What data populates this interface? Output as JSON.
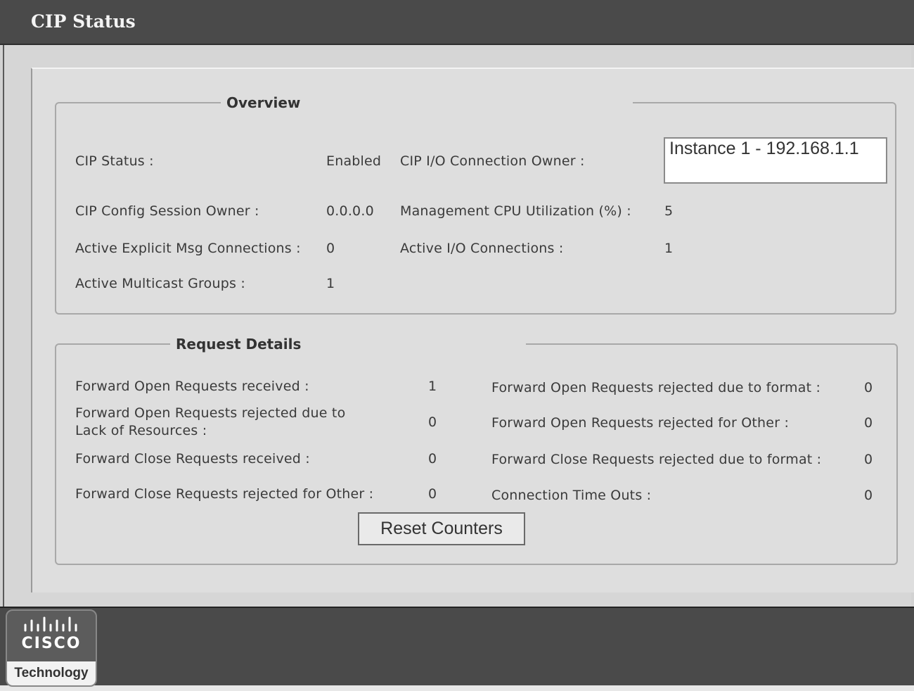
{
  "window": {
    "title": "CIP Status"
  },
  "overview": {
    "legend": "Overview",
    "cip_status_label": "CIP Status :",
    "cip_status_value": "Enabled",
    "io_owner_label": "CIP I/O Connection Owner :",
    "io_owner_value": "Instance 1 - 192.168.1.1",
    "config_owner_label": "CIP Config Session Owner :",
    "config_owner_value": "0.0.0.0",
    "cpu_label": "Management CPU Utilization (%) :",
    "cpu_value": "5",
    "explicit_label": "Active Explicit Msg Connections :",
    "explicit_value": "0",
    "io_conn_label": "Active I/O Connections :",
    "io_conn_value": "1",
    "multicast_label": "Active Multicast Groups :",
    "multicast_value": "1"
  },
  "request_details": {
    "legend": "Request Details",
    "left": [
      {
        "label": "Forward Open Requests received :",
        "value": "1"
      },
      {
        "label_line1": "Forward Open Requests rejected due to",
        "label_line2": "Lack of Resources :",
        "value": "0"
      },
      {
        "label": "Forward Close Requests received :",
        "value": "0"
      },
      {
        "label": "Forward Close Requests rejected for Other :",
        "value": "0"
      }
    ],
    "right": [
      {
        "label": "Forward Open Requests rejected due to format :",
        "value": "0"
      },
      {
        "label": "Forward Open Requests rejected for Other :",
        "value": "0"
      },
      {
        "label": "Forward Close Requests rejected due to format :",
        "value": "0"
      },
      {
        "label": "Connection Time Outs :",
        "value": "0"
      }
    ],
    "reset_button": "Reset Counters"
  },
  "logo": {
    "word": "CISCO",
    "tag": "Technology",
    "icon": "cisco-bridge-logo"
  }
}
